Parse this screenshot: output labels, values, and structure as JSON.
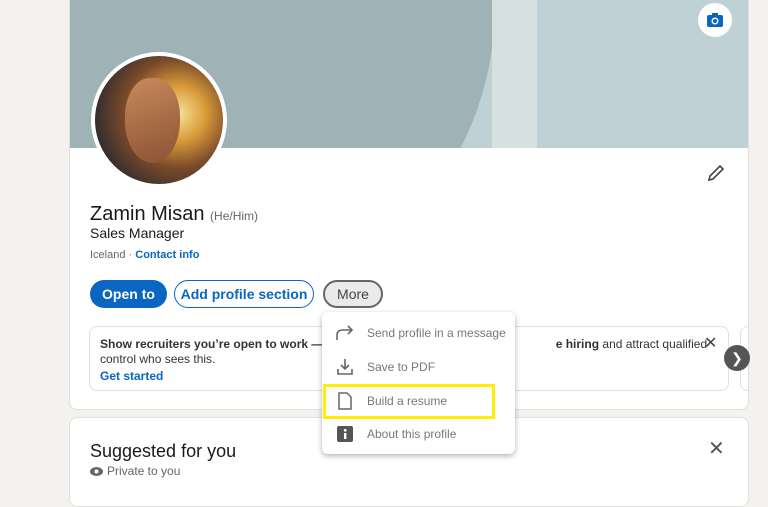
{
  "profile": {
    "name": "Zamin Misan",
    "pronouns": "(He/Him)",
    "headline": "Sales Manager",
    "location": "Iceland",
    "separator": " · ",
    "contact_link": "Contact info"
  },
  "actions": {
    "open_to": "Open to",
    "add_section": "Add profile section",
    "more": "More"
  },
  "open_to_work": {
    "text_start": "Show recruiters you’re open to work — yo",
    "text_bold_end": "e hiring",
    "text_end": " and attract qualified",
    "line2": "control who sees this.",
    "cta": "Get started"
  },
  "more_menu": [
    {
      "icon": "share-arrow-icon",
      "label": "Send profile in a message"
    },
    {
      "icon": "download-icon",
      "label": "Save to PDF"
    },
    {
      "icon": "document-icon",
      "label": "Build a resume"
    },
    {
      "icon": "info-icon",
      "label": "About this profile"
    }
  ],
  "suggested": {
    "title": "Suggested for you",
    "privacy": "Private to you"
  },
  "colors": {
    "brand": "#0a66c2",
    "highlight": "#ffee00"
  }
}
